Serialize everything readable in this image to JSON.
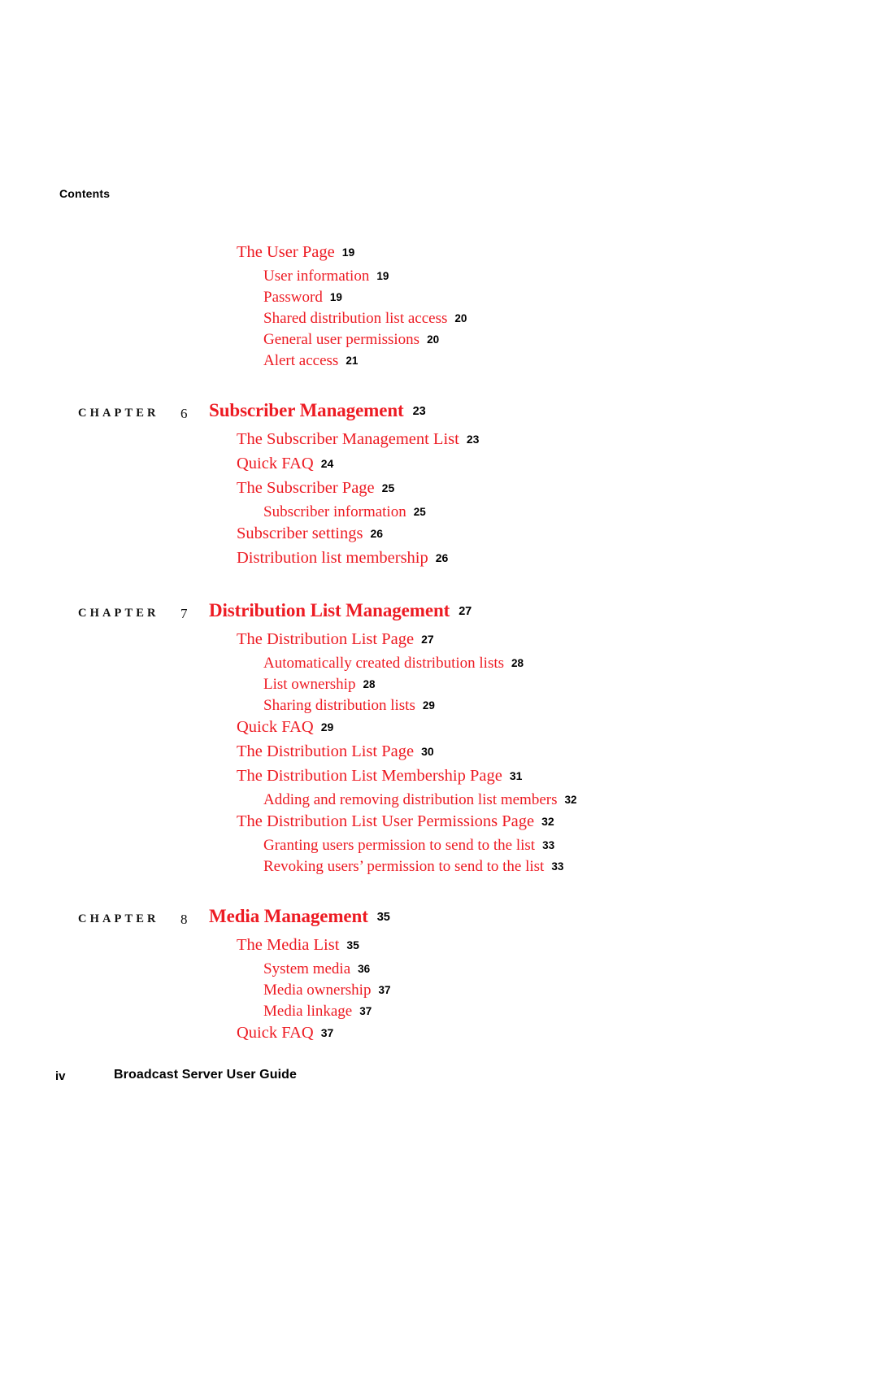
{
  "document": {
    "running_head": "Contents",
    "footer": {
      "folio": "iv",
      "title": "Broadcast Server User Guide"
    },
    "colors": {
      "entry_red": "#ED1B23",
      "page_number_black": "#000000"
    }
  },
  "toc": {
    "groups": [
      {
        "chapter": null,
        "entries": [
          {
            "level": 1,
            "title": "The User Page",
            "page": "19"
          },
          {
            "level": 2,
            "title": "User information",
            "page": "19"
          },
          {
            "level": 2,
            "title": "Password",
            "page": "19"
          },
          {
            "level": 2,
            "title": "Shared distribution list access",
            "page": "20"
          },
          {
            "level": 2,
            "title": "General user permissions",
            "page": "20"
          },
          {
            "level": 2,
            "title": "Alert access",
            "page": "21"
          }
        ]
      },
      {
        "chapter": {
          "label": "CHAPTER",
          "number": "6",
          "title": "Subscriber Management",
          "page": "23"
        },
        "entries": [
          {
            "level": 1,
            "title": "The Subscriber Management List",
            "page": "23"
          },
          {
            "level": 1,
            "title": "Quick FAQ",
            "page": "24"
          },
          {
            "level": 1,
            "title": "The Subscriber Page",
            "page": "25"
          },
          {
            "level": 2,
            "title": "Subscriber information",
            "page": "25"
          },
          {
            "level": 1,
            "title": "Subscriber settings",
            "page": "26"
          },
          {
            "level": 1,
            "title": "Distribution list membership",
            "page": "26"
          }
        ]
      },
      {
        "chapter": {
          "label": "CHAPTER",
          "number": "7",
          "title": "Distribution List Management",
          "page": "27"
        },
        "entries": [
          {
            "level": 1,
            "title": "The Distribution List Page",
            "page": "27"
          },
          {
            "level": 2,
            "title": "Automatically created distribution lists",
            "page": "28"
          },
          {
            "level": 2,
            "title": "List ownership",
            "page": "28"
          },
          {
            "level": 2,
            "title": "Sharing distribution lists",
            "page": "29"
          },
          {
            "level": 1,
            "title": "Quick FAQ",
            "page": "29"
          },
          {
            "level": 1,
            "title": "The Distribution List Page",
            "page": "30"
          },
          {
            "level": 1,
            "title": "The Distribution List Membership Page",
            "page": "31"
          },
          {
            "level": 2,
            "title": "Adding and removing distribution list members",
            "page": "32"
          },
          {
            "level": 1,
            "title": "The Distribution List User Permissions Page",
            "page": "32"
          },
          {
            "level": 2,
            "title": "Granting users permission to send to the list",
            "page": "33"
          },
          {
            "level": 2,
            "title": "Revoking users’ permission to send to the list",
            "page": "33"
          }
        ]
      },
      {
        "chapter": {
          "label": "CHAPTER",
          "number": "8",
          "title": "Media Management",
          "page": "35"
        },
        "entries": [
          {
            "level": 1,
            "title": "The Media List",
            "page": "35"
          },
          {
            "level": 2,
            "title": "System media",
            "page": "36"
          },
          {
            "level": 2,
            "title": "Media ownership",
            "page": "37"
          },
          {
            "level": 2,
            "title": "Media linkage",
            "page": "37"
          },
          {
            "level": 1,
            "title": "Quick FAQ",
            "page": "37"
          }
        ]
      }
    ]
  }
}
